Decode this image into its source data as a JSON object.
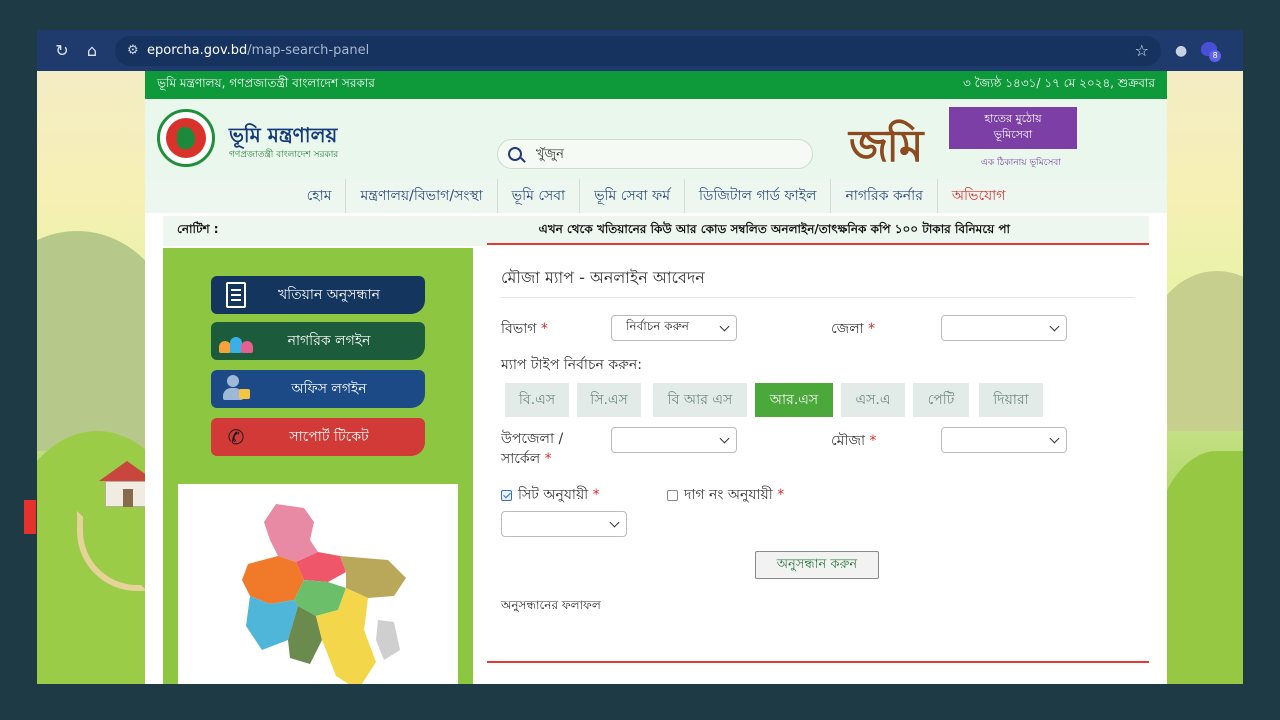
{
  "browser": {
    "url_host": "eporcha.gov.bd",
    "url_path": "/map-search-panel",
    "extension_badge": "8"
  },
  "govbar": {
    "left": "ভূমি মন্ত্রণালয়, গণপ্রজাতন্ত্রী বাংলাদেশ সরকার",
    "right": "৩ জ্যৈষ্ঠ ১৪৩১/ ১৭ মে ২০২৪, শুক্রবার"
  },
  "header": {
    "ministry_title": "ভূমি মন্ত্রণালয়",
    "ministry_sub": "গণপ্রজাতন্ত্রী বাংলাদেশ সরকার",
    "search_placeholder": "খুঁজুন",
    "jomi_word": "জমি",
    "jomi_box_line1": "হাতের মুঠোয়",
    "jomi_box_line2": "ভূমিসেবা",
    "jomi_tagline": "এক ঠিকানায় ভূমিসেবা"
  },
  "nav": [
    {
      "label": "হোম"
    },
    {
      "label": "মন্ত্রণালয়/বিভাগ/সংস্থা"
    },
    {
      "label": "ভূমি সেবা"
    },
    {
      "label": "ভূমি সেবা ফর্ম"
    },
    {
      "label": "ডিজিটাল গার্ড ফাইল"
    },
    {
      "label": "নাগরিক কর্নার"
    },
    {
      "label": "অভিযোগ"
    }
  ],
  "notice": {
    "label": "নোটিশ :",
    "text": "এখন থেকে খতিয়ানের কিউ আর কোড সম্বলিত অনলাইন/তাৎক্ষনিক কপি ১০০ টাকার বিনিময়ে পা"
  },
  "sidebar": {
    "khatian_search": "খতিয়ান অনুসন্ধান",
    "citizen_login": "নাগরিক লগইন",
    "office_login": "অফিস লগইন",
    "support_ticket": "সাপোর্ট টিকেট"
  },
  "panel": {
    "title": "মৌজা ম্যাপ - অনলাইন আবেদন",
    "division_label": "বিভাগ",
    "division_value": "নির্বাচন করুন",
    "district_label": "জেলা",
    "district_value": "",
    "map_type_label": "ম্যাপ টাইপ নির্বাচন করুন:",
    "map_types": [
      "বি.এস",
      "সি.এস",
      "বি আর এস",
      "আর.এস",
      "এস.এ",
      "পেটি",
      "দিয়ারা"
    ],
    "upazila_label_line1": "উপজেলা /",
    "upazila_label_line2": "সার্কেল",
    "upazila_value": "",
    "mouza_label": "মৌজা",
    "mouza_value": "",
    "sheet_label": "সিট অনুযায়ী",
    "dag_label": "দাগ নং অনুযায়ী",
    "sheet_value": "",
    "search_button": "অনুসন্ধান করুন",
    "results_label": "অনুসন্ধানের ফলাফল",
    "required_mark": "*"
  },
  "colors": {
    "gov_green": "#0e9a3a",
    "active_maptype": "#4aa93a",
    "accent_red": "#e53935"
  }
}
